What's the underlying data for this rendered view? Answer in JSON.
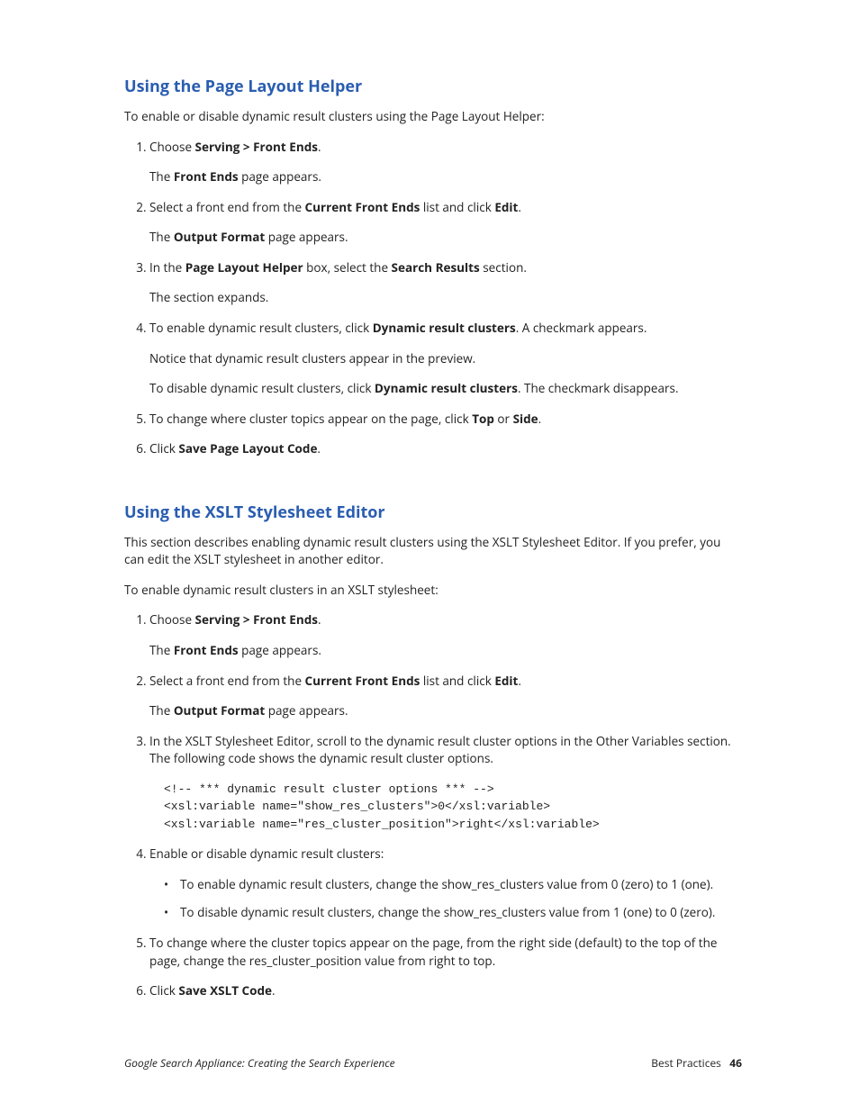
{
  "section1": {
    "heading": "Using the Page Layout Helper",
    "intro": "To enable or disable dynamic result clusters using the Page Layout Helper:",
    "steps": [
      {
        "html": "Choose <b>Serving > Front Ends</b>.",
        "subs": [
          "The <b>Front Ends</b> page appears."
        ]
      },
      {
        "html": "Select a front end from the <b>Current Front Ends</b> list and click <b>Edit</b>.",
        "subs": [
          "The <b>Output Format</b> page appears."
        ]
      },
      {
        "html": "In the <b>Page Layout Helper</b> box, select the <b>Search Results</b> section.",
        "subs": [
          "The section expands."
        ]
      },
      {
        "html": "To enable dynamic result clusters, click <b>Dynamic result clusters</b>. A checkmark appears.",
        "subs": [
          "Notice that dynamic result clusters appear in the preview.",
          "To disable dynamic result clusters, click <b>Dynamic result clusters</b>. The checkmark disappears."
        ]
      },
      {
        "html": "To change where cluster topics appear on the page, click <b>Top</b> or <b>Side</b>.",
        "subs": []
      },
      {
        "html": "Click <b>Save Page Layout Code</b>.",
        "subs": []
      }
    ]
  },
  "section2": {
    "heading": "Using the XSLT Stylesheet Editor",
    "intro": "This section describes enabling dynamic result clusters using the XSLT Stylesheet Editor. If you prefer, you can edit the XSLT stylesheet in another editor.",
    "lead": "To enable dynamic result clusters in an XSLT stylesheet:",
    "steps": [
      {
        "html": "Choose <b>Serving > Front Ends</b>.",
        "subs": [
          "The <b>Front Ends</b> page appears."
        ]
      },
      {
        "html": "Select a front end from the <b>Current Front Ends</b> list and click <b>Edit</b>.",
        "subs": [
          "The <b>Output Format</b> page appears."
        ]
      },
      {
        "html": "In the XSLT Stylesheet Editor, scroll to the dynamic result cluster options in the Other Variables section. The following code shows the dynamic result cluster options.",
        "code": "<!-- *** dynamic result cluster options *** -->\n<xsl:variable name=\"show_res_clusters\">0</xsl:variable>\n<xsl:variable name=\"res_cluster_position\">right</xsl:variable>"
      },
      {
        "html": "Enable or disable dynamic result clusters:",
        "bullets": [
          "To enable dynamic result clusters, change the show_res_clusters value from 0 (zero) to 1 (one).",
          "To disable dynamic result clusters, change the show_res_clusters value from 1 (one) to 0 (zero)."
        ]
      },
      {
        "html": "To change where the cluster topics appear on the page, from the right side (default) to the top of the page, change the res_cluster_position value from right to top.",
        "subs": []
      },
      {
        "html": "Click <b>Save XSLT Code</b>.",
        "subs": []
      }
    ]
  },
  "footer": {
    "left": "Google Search Appliance: Creating the Search Experience",
    "right_label": "Best Practices",
    "page": "46"
  }
}
